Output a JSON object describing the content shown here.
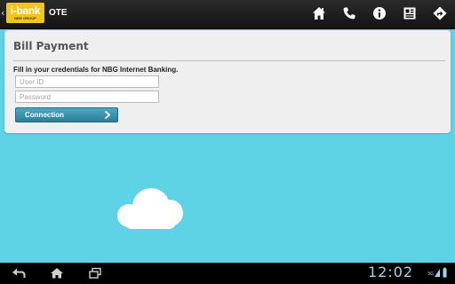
{
  "header": {
    "logo_text": "i-bank",
    "logo_subtext": "NBG GROUP",
    "title": "OTE",
    "icons": [
      "home-icon",
      "phone-icon",
      "info-icon",
      "contacts-icon",
      "directions-icon"
    ]
  },
  "form": {
    "title": "Bill Payment",
    "instructions": "Fill in your credentials for NBG Internet Banking.",
    "user_id_placeholder": "User ID",
    "password_placeholder": "Password",
    "connect_label": "Connection"
  },
  "system_bar": {
    "time": "12:02",
    "network": "3G",
    "nav_icons": [
      "back-icon",
      "home-icon",
      "recent-apps-icon"
    ]
  },
  "colors": {
    "background": "#5fd3e6",
    "logo_yellow": "#f3c51a",
    "button_teal": "#3592ab",
    "card": "#efefef"
  }
}
